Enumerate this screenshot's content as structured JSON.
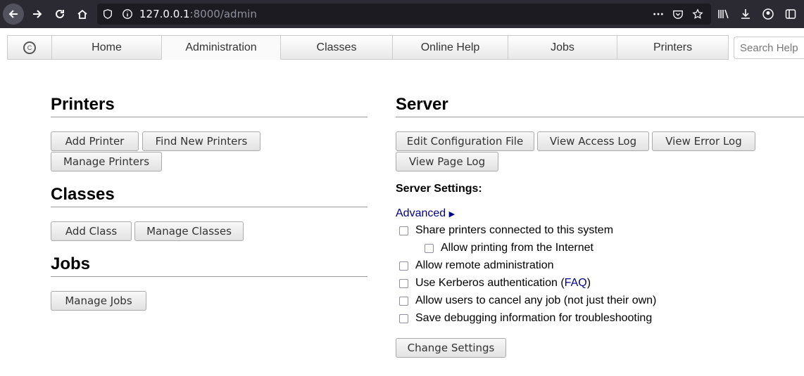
{
  "browser": {
    "url_host": "127.0.0.1",
    "url_rest": ":8000/admin"
  },
  "header": {
    "tabs": [
      {
        "label": "Home"
      },
      {
        "label": "Administration"
      },
      {
        "label": "Classes"
      },
      {
        "label": "Online Help"
      },
      {
        "label": "Jobs"
      },
      {
        "label": "Printers"
      }
    ],
    "search_placeholder": "Search Help"
  },
  "printers": {
    "title": "Printers",
    "add_printer": "Add Printer",
    "find_new_printers": "Find New Printers",
    "manage_printers": "Manage Printers"
  },
  "classes": {
    "title": "Classes",
    "add_class": "Add Class",
    "manage_classes": "Manage Classes"
  },
  "jobs": {
    "title": "Jobs",
    "manage_jobs": "Manage Jobs"
  },
  "server": {
    "title": "Server",
    "edit_config": "Edit Configuration File",
    "view_access_log": "View Access Log",
    "view_error_log": "View Error Log",
    "view_page_log": "View Page Log",
    "settings_label": "Server Settings:",
    "advanced": "Advanced",
    "advanced_arrow": "▶",
    "options": {
      "share_printers": "Share printers connected to this system",
      "allow_internet": "Allow printing from the Internet",
      "remote_admin": "Allow remote administration",
      "kerberos_prefix": "Use Kerberos authentication (",
      "kerberos_link": "FAQ",
      "kerberos_suffix": ")",
      "cancel_any_job": "Allow users to cancel any job (not just their own)",
      "debug_info": "Save debugging information for troubleshooting"
    },
    "change_settings": "Change Settings"
  }
}
